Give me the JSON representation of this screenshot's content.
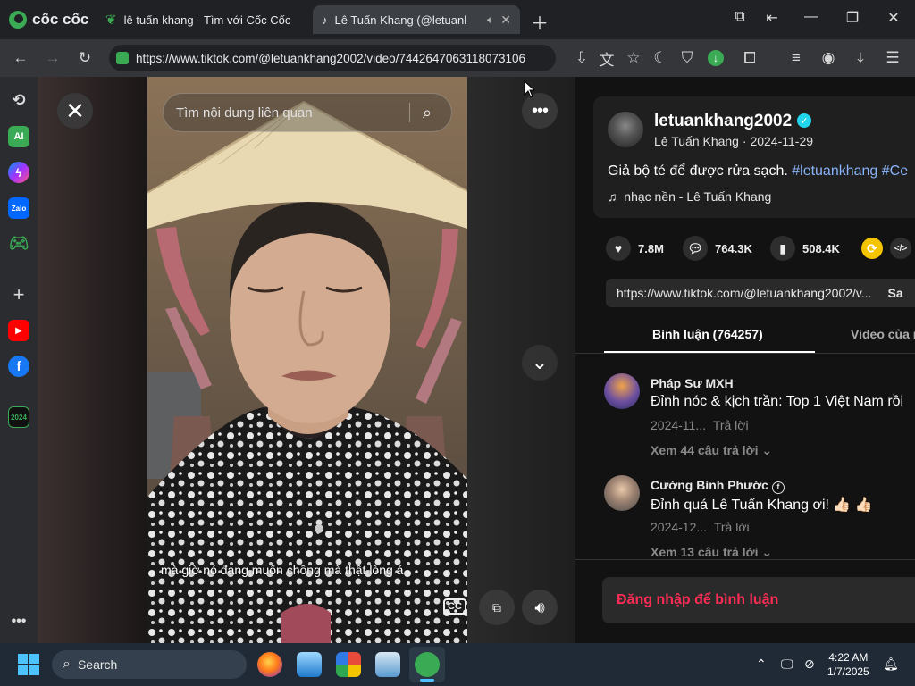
{
  "browser": {
    "brand": "cốc cốc",
    "tabs": [
      {
        "title": "lê tuấn khang - Tìm với Cốc Cốc"
      },
      {
        "title": "Lê Tuấn Khang (@letuanl"
      }
    ],
    "url": "https://www.tiktok.com/@letuankhang2002/video/7442647063118073106"
  },
  "search": {
    "placeholder": "Tìm nội dung liên quan"
  },
  "video": {
    "caption": "mà giờ nó đang muốn chồng mà thật lòng á"
  },
  "post": {
    "username": "letuankhang2002",
    "display_name": "Lê Tuấn Khang",
    "date": "2024-11-29",
    "description": "Giả bộ té để được rửa sạch. ",
    "hashtag1": "#letuankhang",
    "hashtag2": "#Ce",
    "music": "nhạc nền - Lê Tuấn Khang",
    "likes": "7.8M",
    "comments": "764.3K",
    "saves": "508.4K",
    "share_link": "https://www.tiktok.com/@letuankhang2002/v...",
    "copy_label": "Sa"
  },
  "panel_tabs": {
    "comments": "Bình luận (764257)",
    "videos": "Video của n"
  },
  "comments": [
    {
      "author": "Pháp Sư MXH",
      "text": "Đỉnh nóc & kịch trần: Top 1 Việt Nam rồi",
      "date": "2024-11...",
      "reply": "Trả lời",
      "more": "Xem 44 câu trả lời"
    },
    {
      "author": "Cường Bình Phước",
      "text": "Đỉnh quá Lê Tuấn Khang ơi! 👍🏻 👍🏻",
      "date": "2024-12...",
      "reply": "Trả lời",
      "more": "Xem 13 câu trả lời"
    }
  ],
  "login_prompt": "Đăng nhập để bình luận",
  "taskbar": {
    "search_label": "Search",
    "time": "4:22 AM",
    "date": "1/7/2025"
  },
  "colors": {
    "tiktok_red": "#fe2c55",
    "hashtag": "#8ab4f8",
    "coccoc_green": "#3aaa55"
  }
}
